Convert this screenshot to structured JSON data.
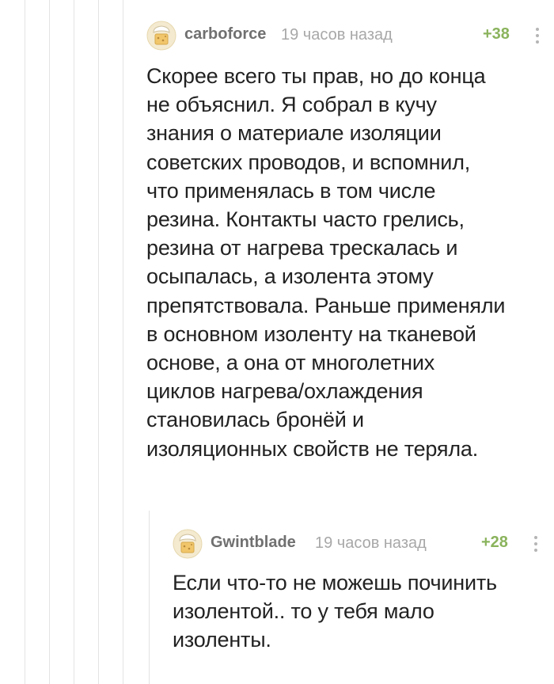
{
  "comments": [
    {
      "author": "carboforce",
      "time": "19 часов назад",
      "rating": "+38",
      "lines": [
        "Скорее всего ты прав, но до конца",
        "не объяснил. Я собрал в кучу",
        "знания о материале изоляции",
        "советских проводов, и вспомнил,",
        "что применялась в том числе",
        "резина. Контакты часто грелись,",
        "резина от нагрева трескалась и",
        "осыпалась, а изолента этому",
        "препятствовала. Раньше применяли",
        "в основном изоленту на тканевой",
        "основе, а она от многолетних",
        "циклов нагрева/охлаждения",
        "становилась бронёй и",
        "изоляционных свойств не теряла."
      ]
    },
    {
      "author": "Gwintblade",
      "time": "19 часов назад",
      "rating": "+28",
      "lines": [
        "Если что-то не можешь починить",
        "изолентой.. то у тебя мало",
        "изоленты."
      ]
    }
  ],
  "colors": {
    "author": "#707070",
    "timestamp": "#a8a8a8",
    "rating": "#8ab35c",
    "text": "#222222",
    "thread_line": "#e3e3e3"
  },
  "icons": {
    "avatar": "default-avatar-icon",
    "more": "more-vertical-icon"
  }
}
